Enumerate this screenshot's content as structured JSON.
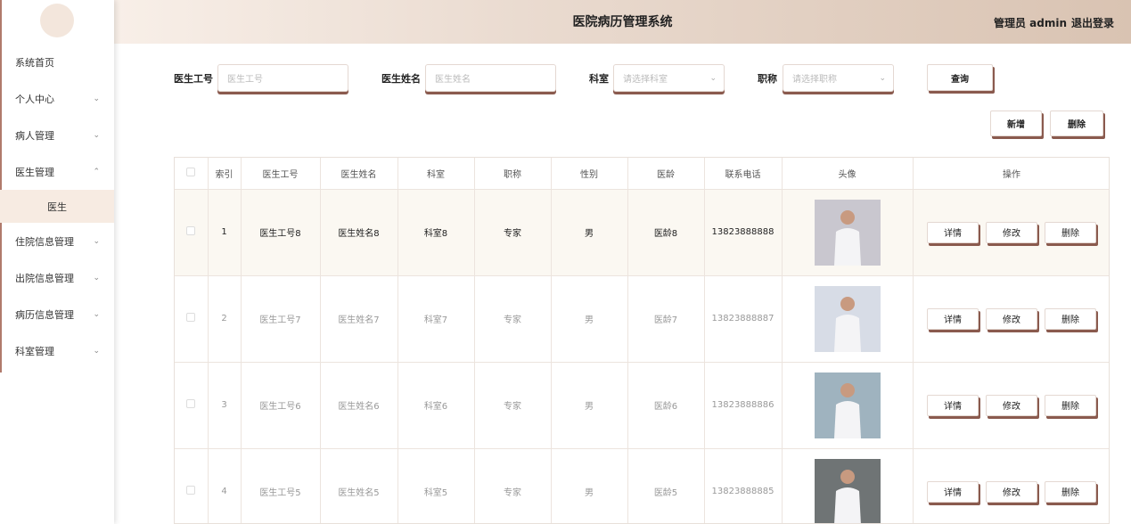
{
  "header": {
    "title": "医院病历管理系统",
    "user": "管理员 admin",
    "logout": "退出登录"
  },
  "sidebar": {
    "items": [
      {
        "label": "系统首页",
        "has_chevron": false
      },
      {
        "label": "个人中心",
        "has_chevron": true
      },
      {
        "label": "病人管理",
        "has_chevron": true
      },
      {
        "label": "医生管理",
        "has_chevron": true,
        "expanded": true
      },
      {
        "label": "医生",
        "sub": true
      },
      {
        "label": "住院信息管理",
        "has_chevron": true
      },
      {
        "label": "出院信息管理",
        "has_chevron": true
      },
      {
        "label": "病历信息管理",
        "has_chevron": true
      },
      {
        "label": "科室管理",
        "has_chevron": true
      }
    ]
  },
  "search": {
    "doctor_id_label": "医生工号",
    "doctor_id_placeholder": "医生工号",
    "doctor_name_label": "医生姓名",
    "doctor_name_placeholder": "医生姓名",
    "dept_label": "科室",
    "dept_placeholder": "请选择科室",
    "title_label": "职称",
    "title_placeholder": "请选择职称",
    "query_button": "查询"
  },
  "actions": {
    "add_button": "新增",
    "delete_button": "删除"
  },
  "table": {
    "headers": [
      "",
      "索引",
      "医生工号",
      "医生姓名",
      "科室",
      "职称",
      "性别",
      "医龄",
      "联系电话",
      "头像",
      "操作"
    ],
    "rows": [
      {
        "index": "1",
        "id": "医生工号8",
        "name": "医生姓名8",
        "dept": "科室8",
        "title": "专家",
        "gender": "男",
        "age": "医龄8",
        "phone": "13823888888",
        "photo_color": "#c9c7cf"
      },
      {
        "index": "2",
        "id": "医生工号7",
        "name": "医生姓名7",
        "dept": "科室7",
        "title": "专家",
        "gender": "男",
        "age": "医龄7",
        "phone": "13823888887",
        "photo_color": "#d7dce6"
      },
      {
        "index": "3",
        "id": "医生工号6",
        "name": "医生姓名6",
        "dept": "科室6",
        "title": "专家",
        "gender": "男",
        "age": "医龄6",
        "phone": "13823888886",
        "photo_color": "#9fb3bf"
      },
      {
        "index": "4",
        "id": "医生工号5",
        "name": "医生姓名5",
        "dept": "科室5",
        "title": "专家",
        "gender": "男",
        "age": "医龄5",
        "phone": "13823888885",
        "photo_color": "#6f7475"
      }
    ],
    "ops": {
      "detail": "详情",
      "edit": "修改",
      "delete": "删除"
    }
  },
  "colors": {
    "accent_shadow": "#8a5a4e",
    "sidebar_selected_bg": "#f7ebe2",
    "header_gradient_end": "#d9c3b2"
  }
}
